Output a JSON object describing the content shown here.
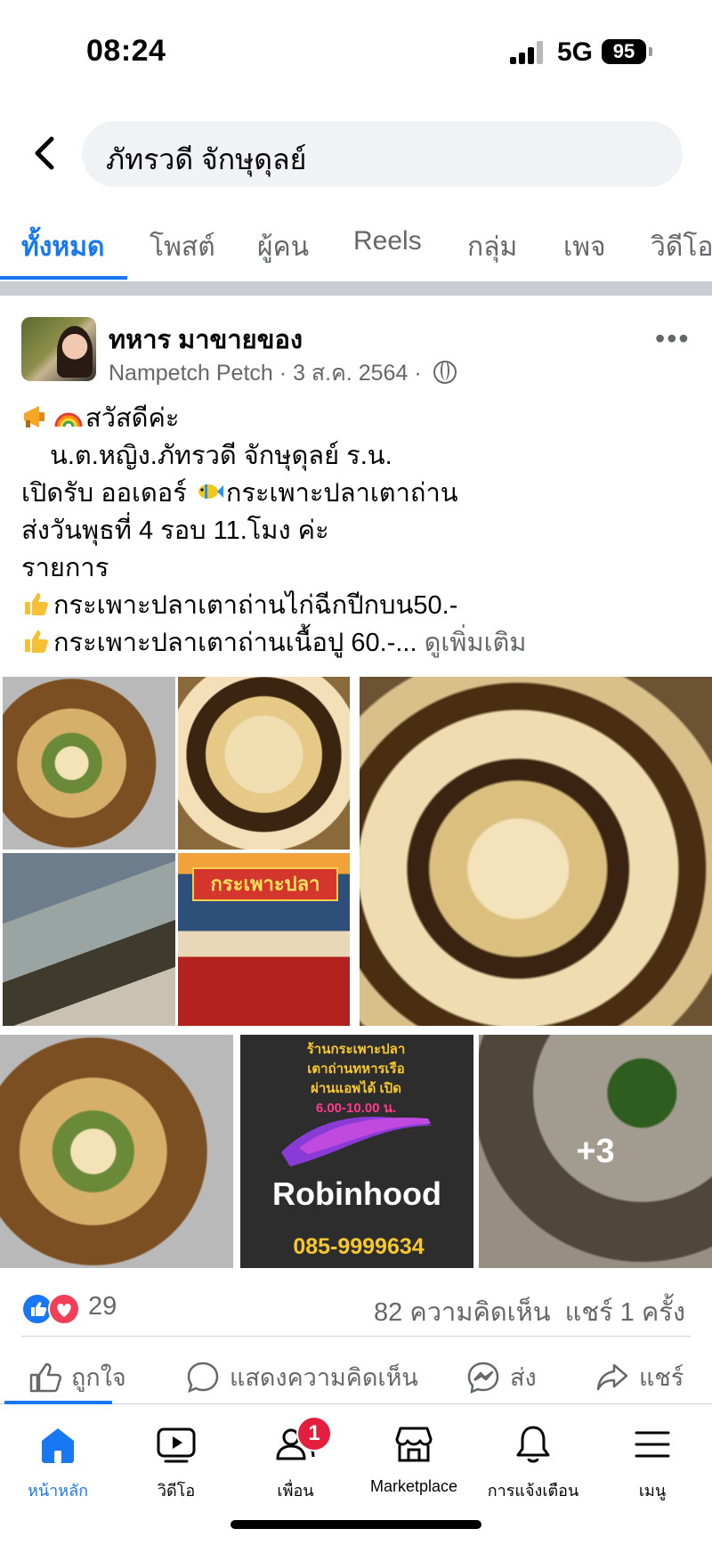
{
  "status_bar": {
    "time": "08:24",
    "network": "5G",
    "battery": "95"
  },
  "search": {
    "query": "ภัทรวดี จักษุดุลย์"
  },
  "tabs": [
    {
      "label": "ทั้งหมด",
      "active": true
    },
    {
      "label": "โพสต์"
    },
    {
      "label": "ผู้คน"
    },
    {
      "label": "Reels"
    },
    {
      "label": "กลุ่ม"
    },
    {
      "label": "เพจ"
    },
    {
      "label": "วิดีโอ"
    }
  ],
  "post": {
    "page_name": "ทหาร มาขายของ",
    "author": "Nampetch Petch",
    "date": "3 ส.ค. 2564",
    "separator": "·",
    "lines": [
      "สวัสดีค่ะ",
      "น.ต.หญิง.ภัทรวดี จักษุดุลย์ ร.น.",
      "เปิดรับ ออเดอร์ ",
      "กระเพาะปลาเตาถ่าน",
      "ส่งวันพุธที่ 4 รอบ 11.โมง ค่ะ",
      "รายการ",
      "กระเพาะปลาเตาถ่านไก่ฉีกปีกบน50.-",
      "กระเพาะปลาเตาถ่านเนื้อปู  60.-..."
    ],
    "see_more": "ดูเพิ่มเติม",
    "photos": {
      "cart_label": "กระเพาะปลา",
      "robinhood_top": [
        "ร้านกระเพาะปลา",
        "เตาถ่านทหารเรือ",
        "ผ่านแอพได้ เปิด",
        "6.00-10.00 น."
      ],
      "robinhood_name": "Robinhood",
      "robinhood_phone": "085-9999634",
      "more_count": "+3"
    },
    "reaction_count": "29",
    "comments": "82 ความคิดเห็น",
    "shares": "แชร์ 1 ครั้ง",
    "actions": {
      "like": "ถูกใจ",
      "comment": "แสดงความคิดเห็น",
      "send": "ส่ง",
      "share": "แชร์"
    }
  },
  "bottom_nav": [
    {
      "label": "หน้าหลัก",
      "icon": "home-icon",
      "active": true
    },
    {
      "label": "วิดีโอ",
      "icon": "video-icon"
    },
    {
      "label": "เพื่อน",
      "icon": "friends-icon",
      "badge": "1"
    },
    {
      "label": "Marketplace",
      "icon": "marketplace-icon"
    },
    {
      "label": "การแจ้งเตือน",
      "icon": "bell-icon"
    },
    {
      "label": "เมนู",
      "icon": "menu-icon"
    }
  ],
  "colors": {
    "accent": "#1877f2",
    "secondary_text": "#65676b",
    "badge": "#e41e3f"
  }
}
